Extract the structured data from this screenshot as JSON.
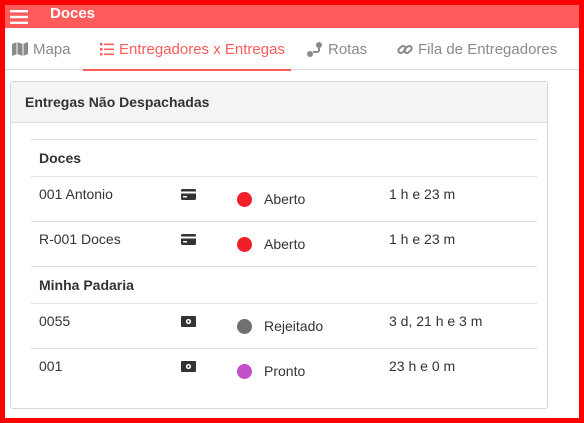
{
  "app": {
    "title": "Doces"
  },
  "tabs": [
    {
      "label": "Mapa",
      "icon": "map-icon"
    },
    {
      "label": "Entregadores x Entregas",
      "icon": "list-icon"
    },
    {
      "label": "Rotas",
      "icon": "route-icon"
    },
    {
      "label": "Fila de Entregadores",
      "icon": "link-icon"
    }
  ],
  "colors": {
    "accent": "#ff5b5b",
    "status_aberto": "#f0202a",
    "status_rejeitado": "#707070",
    "status_pronto": "#c24fc9"
  },
  "panel": {
    "title": "Entregas Não Despachadas",
    "groups": [
      {
        "name": "Doces",
        "rows": [
          {
            "name": "001 Antonio",
            "payment_icon": "credit-card-icon",
            "status": "Aberto",
            "status_color": "#f0202a",
            "time": "1 h e 23 m"
          },
          {
            "name": "R-001 Doces",
            "payment_icon": "credit-card-icon",
            "status": "Aberto",
            "status_color": "#f0202a",
            "time": "1 h e 23 m"
          }
        ]
      },
      {
        "name": "Minha Padaria",
        "rows": [
          {
            "name": "0055",
            "payment_icon": "cash-icon",
            "status": "Rejeitado",
            "status_color": "#707070",
            "time": "3 d, 21 h e 3 m"
          },
          {
            "name": "001",
            "payment_icon": "cash-icon",
            "status": "Pronto",
            "status_color": "#c24fc9",
            "time": "23 h e 0 m"
          }
        ]
      }
    ]
  }
}
